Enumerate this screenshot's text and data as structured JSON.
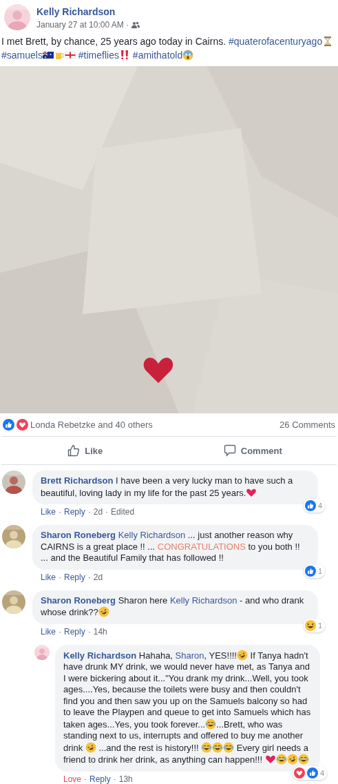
{
  "post": {
    "author": "Kelly Richardson",
    "time": "January 27 at 10:00 AM ·",
    "text": [
      {
        "kind": "text",
        "text": "I met Brett, by chance, 25 years ago today in Cairns. "
      },
      {
        "kind": "link",
        "text": "#quaterofacenturyago"
      },
      {
        "kind": "hourglass"
      },
      {
        "kind": "space"
      },
      {
        "kind": "link",
        "text": "#samuels"
      },
      {
        "kind": "flag-au"
      },
      {
        "kind": "beer"
      },
      {
        "kind": "flag-en"
      },
      {
        "kind": "space"
      },
      {
        "kind": "link",
        "text": "#timeflies"
      },
      {
        "kind": "bangbang"
      },
      {
        "kind": "space"
      },
      {
        "kind": "link",
        "text": "#amithatold"
      },
      {
        "kind": "scream"
      }
    ]
  },
  "stats": {
    "reactions": [
      {
        "kind": "like"
      },
      {
        "kind": "love"
      }
    ],
    "summary": "Londa Rebetzke and 40 others",
    "comments": "26 Comments"
  },
  "actions": [
    {
      "kind": "like",
      "label": "Like"
    },
    {
      "kind": "comment",
      "label": "Comment"
    }
  ],
  "separator": "·",
  "comments": [
    {
      "author": "Brett Richardson",
      "reply": false,
      "body": [
        {
          "kind": "text",
          "text": "I have been a very lucky man to have such a beautiful, loving lady in my life for the past 25 years."
        },
        {
          "kind": "heart"
        }
      ],
      "meta": [
        {
          "kind": "reaction",
          "text": "Like",
          "reacted": false
        },
        {
          "kind": "action",
          "text": "Reply"
        },
        {
          "kind": "time",
          "text": "2d"
        },
        {
          "kind": "note",
          "text": "Edited"
        }
      ],
      "reactions": [
        {
          "kind": "like"
        }
      ],
      "count": "4"
    },
    {
      "author": "Sharon Roneberg",
      "reply": false,
      "body": [
        {
          "kind": "link",
          "text": "Kelly Richardson"
        },
        {
          "kind": "text",
          "text": " ... just another reason why CAIRNS is a great place !! ... "
        },
        {
          "kind": "highlight",
          "text": "CONGRATULATIONS"
        },
        {
          "kind": "text",
          "text": " to you both !! ... and the Beautiful Family that has followed !!"
        }
      ],
      "meta": [
        {
          "kind": "reaction",
          "text": "Like",
          "reacted": false
        },
        {
          "kind": "action",
          "text": "Reply"
        },
        {
          "kind": "time",
          "text": "2d"
        }
      ],
      "reactions": [
        {
          "kind": "like"
        }
      ],
      "count": "1"
    },
    {
      "author": "Sharon Roneberg",
      "reply": false,
      "body": [
        {
          "kind": "text",
          "text": "Sharon here "
        },
        {
          "kind": "link",
          "text": "Kelly Richardson"
        },
        {
          "kind": "text",
          "text": " - and who drank whose drink??"
        },
        {
          "kind": "rofl"
        }
      ],
      "meta": [
        {
          "kind": "reaction",
          "text": "Like",
          "reacted": false
        },
        {
          "kind": "action",
          "text": "Reply"
        },
        {
          "kind": "time",
          "text": "14h"
        }
      ],
      "reactions": [
        {
          "kind": "haha"
        }
      ],
      "count": "1"
    },
    {
      "author": "Kelly Richardson",
      "reply": true,
      "body": [
        {
          "kind": "text",
          "text": "Hahaha, "
        },
        {
          "kind": "link",
          "text": "Sharon"
        },
        {
          "kind": "text",
          "text": ", YES!!!!"
        },
        {
          "kind": "rofl"
        },
        {
          "kind": "text",
          "text": " If Tanya hadn't have drunk MY drink, we would never have met, as Tanya and I were bickering about it...\"You drank my drink...Well, you took ages....Yes, because the toilets were busy and then couldn't find you and then saw you up on the Samuels balcony so had to leave the Playpen and queue to get into Samuels which has taken ages...Yes, you took forever..."
        },
        {
          "kind": "joy"
        },
        {
          "kind": "text",
          "text": "...Brett, who was standing next to us, interrupts and offered to buy me another drink "
        },
        {
          "kind": "rofl"
        },
        {
          "kind": "text",
          "text": " ...and the rest is history!!! "
        },
        {
          "kind": "joy"
        },
        {
          "kind": "joy"
        },
        {
          "kind": "joy"
        },
        {
          "kind": "text",
          "text": " Every girl needs a friend to drink her drink, as anything can happen!!! "
        },
        {
          "kind": "heart"
        },
        {
          "kind": "joy"
        },
        {
          "kind": "rofl"
        },
        {
          "kind": "joy"
        }
      ],
      "meta": [
        {
          "kind": "reaction",
          "text": "Love",
          "reacted": true
        },
        {
          "kind": "action",
          "text": "Reply"
        },
        {
          "kind": "time",
          "text": "13h"
        }
      ],
      "reactions": [
        {
          "kind": "love"
        },
        {
          "kind": "like"
        }
      ],
      "count": "4"
    }
  ]
}
